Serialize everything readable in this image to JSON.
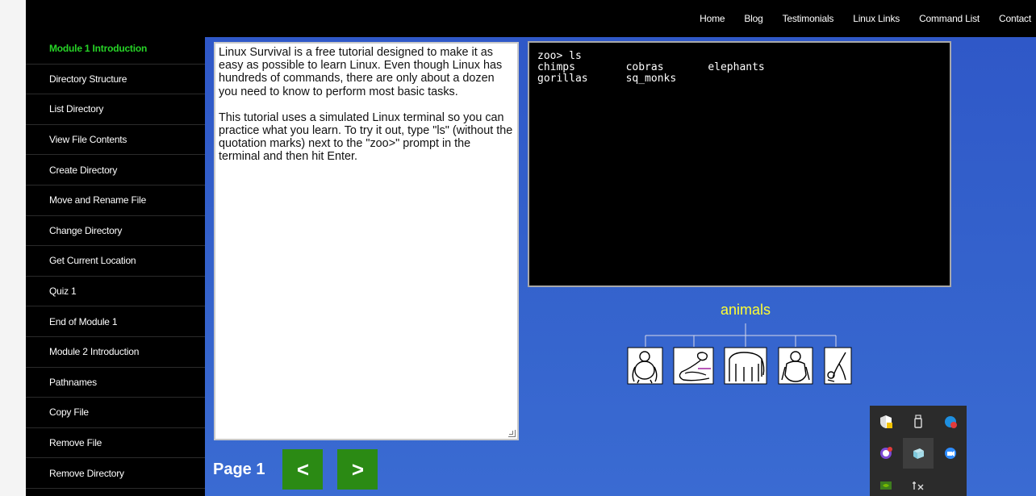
{
  "nav": {
    "items": [
      "Home",
      "Blog",
      "Testimonials",
      "Linux Links",
      "Command List",
      "Contact"
    ]
  },
  "sidebar": {
    "items": [
      {
        "label": "Module 1 Introduction",
        "active": true
      },
      {
        "label": "Directory Structure"
      },
      {
        "label": "List Directory"
      },
      {
        "label": "View File Contents"
      },
      {
        "label": "Create Directory"
      },
      {
        "label": "Move and Rename File"
      },
      {
        "label": "Change Directory"
      },
      {
        "label": "Get Current Location"
      },
      {
        "label": "Quiz 1"
      },
      {
        "label": "End of Module 1"
      },
      {
        "label": "Module 2 Introduction"
      },
      {
        "label": "Pathnames"
      },
      {
        "label": "Copy File"
      },
      {
        "label": "Remove File"
      },
      {
        "label": "Remove Directory"
      }
    ]
  },
  "lesson": {
    "paragraphs": [
      "Linux Survival is a free tutorial designed to make it as easy as possible to learn Linux. Even though Linux has hundreds of commands, there are only about a dozen you need to know to perform most basic tasks.",
      "This tutorial uses a simulated Linux terminal so you can practice what you learn. To try it out, type \"ls\" (without the quotation marks) next to the \"zoo>\" prompt in the terminal and then hit Enter."
    ]
  },
  "terminal": {
    "lines": [
      "zoo> ls",
      "chimps        cobras       elephants",
      "gorillas      sq_monks"
    ]
  },
  "tree": {
    "root": "animals",
    "children": [
      "chimp-icon",
      "cobra-icon",
      "elephant-icon",
      "gorilla-icon",
      "squirrel-monkey-icon"
    ]
  },
  "pager": {
    "label": "Page 1",
    "prev": "<",
    "next": ">"
  },
  "tray": {
    "icons": [
      "security-warning-icon",
      "usb-device-icon",
      "chat-app-icon",
      "messenger-icon",
      "cube-app-icon",
      "video-call-icon",
      "gpu-icon",
      "network-icon"
    ]
  },
  "colors": {
    "active_nav": "#27d427",
    "page_button": "#2b8a14",
    "tree_label": "#ffff33"
  }
}
